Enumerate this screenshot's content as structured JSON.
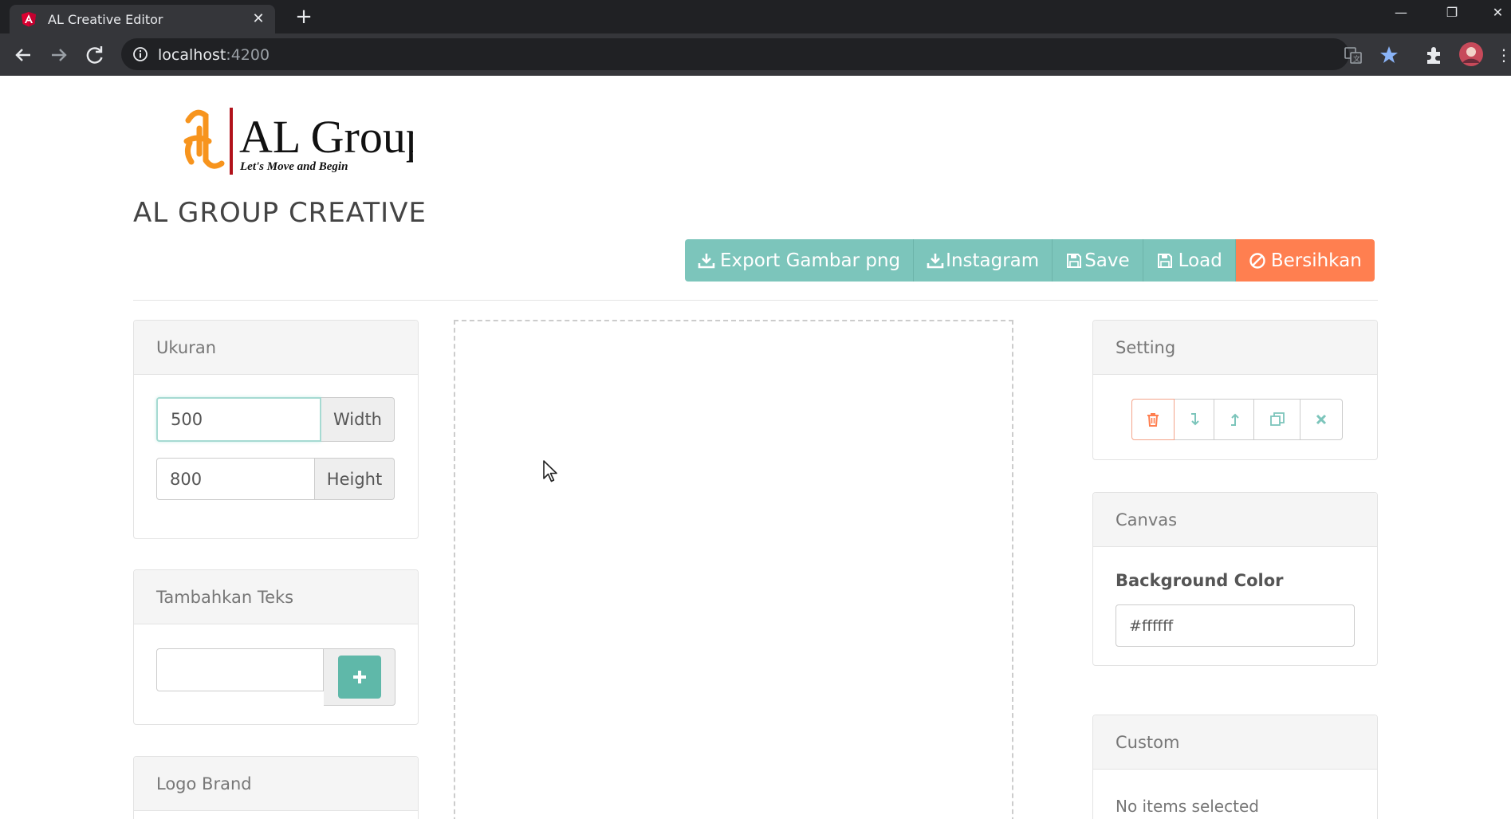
{
  "browser": {
    "tab_title": "AL Creative Editor",
    "url_host": "localhost",
    "url_port": ":4200"
  },
  "header": {
    "logo_text": "AL Group",
    "logo_tagline": "Let's Move and Begin",
    "title": "AL GROUP CREATIVE"
  },
  "actions": {
    "export_png": "Export Gambar png",
    "instagram": "Instagram",
    "save": "Save",
    "load": "Load",
    "clear": "Bersihkan"
  },
  "ukuran": {
    "heading": "Ukuran",
    "width_value": "500",
    "width_label": "Width",
    "height_value": "800",
    "height_label": "Height"
  },
  "tambah_teks": {
    "heading": "Tambahkan Teks",
    "input_value": ""
  },
  "logo_brand": {
    "heading": "Logo Brand"
  },
  "setting": {
    "heading": "Setting",
    "tools": [
      "trash-icon",
      "send-backward-icon",
      "bring-forward-icon",
      "clone-icon",
      "deselect-icon"
    ]
  },
  "canvas_panel": {
    "heading": "Canvas",
    "bg_label": "Background Color",
    "bg_value": "#ffffff"
  },
  "custom": {
    "heading": "Custom",
    "empty_text": "No items selected"
  },
  "colors": {
    "teal": "#7cc5bb",
    "orange": "#ff7f50",
    "logo_orange": "#f7941d"
  }
}
